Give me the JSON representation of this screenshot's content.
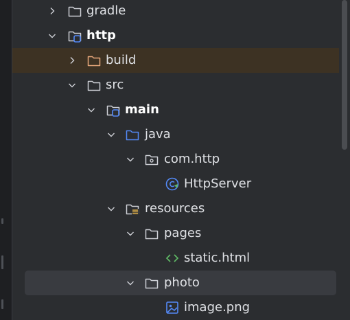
{
  "colors": {
    "folder_stroke": "#ced0d6",
    "java_folder": "#548af7",
    "build_folder": "#e8a87c",
    "module_badge": "#548af7",
    "class_icon": "#548af7",
    "html_icon": "#5fb865",
    "selection": "#393b40",
    "build_highlight": "#3d3223"
  },
  "tree": {
    "items": [
      {
        "label": "gradle",
        "icon": "folder-icon",
        "expanded": false
      },
      {
        "label": "http",
        "icon": "module-folder-icon",
        "expanded": true
      },
      {
        "label": "build",
        "icon": "excluded-folder-icon",
        "expanded": false
      },
      {
        "label": "src",
        "icon": "folder-icon",
        "expanded": true
      },
      {
        "label": "main",
        "icon": "module-folder-icon",
        "expanded": true
      },
      {
        "label": "java",
        "icon": "source-folder-icon",
        "expanded": true
      },
      {
        "label": "com.http",
        "icon": "package-icon",
        "expanded": true
      },
      {
        "label": "HttpServer",
        "icon": "java-class-icon"
      },
      {
        "label": "resources",
        "icon": "resources-folder-icon",
        "expanded": true
      },
      {
        "label": "pages",
        "icon": "folder-icon",
        "expanded": true
      },
      {
        "label": "static.html",
        "icon": "html-file-icon"
      },
      {
        "label": "photo",
        "icon": "folder-icon",
        "expanded": true,
        "selected": true
      },
      {
        "label": "image.png",
        "icon": "image-file-icon"
      }
    ]
  }
}
